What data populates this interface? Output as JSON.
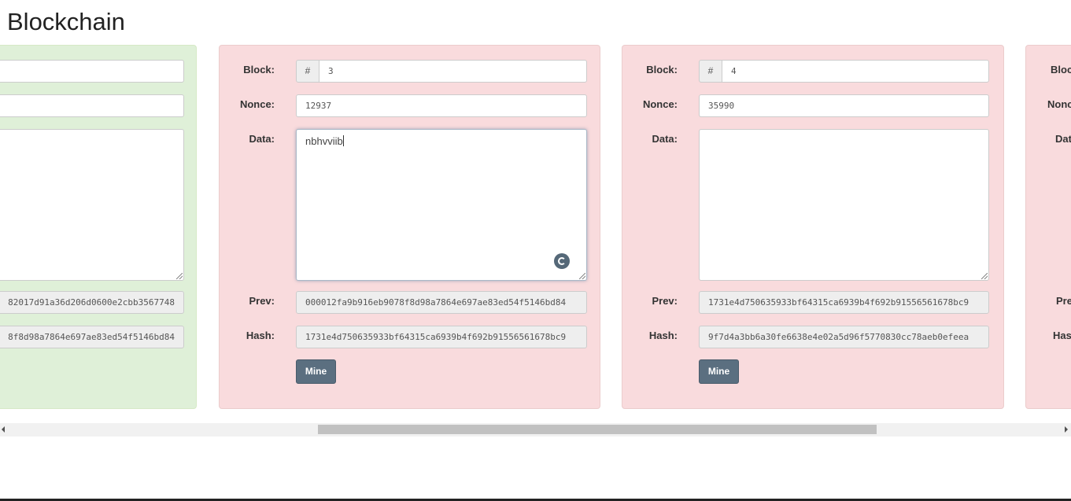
{
  "page": {
    "title": "Blockchain"
  },
  "labels": {
    "block": "Block:",
    "nonce": "Nonce:",
    "data": "Data:",
    "prev": "Prev:",
    "hash": "Hash:",
    "mine": "Mine",
    "hash_prefix": "#"
  },
  "labels_cut": {
    "block": "Block",
    "nonce": "Nonc",
    "data": "Dat",
    "prev": "Pre",
    "hash": "Has"
  },
  "blocks": [
    {
      "status": "valid",
      "block": "",
      "nonce": "",
      "data": "",
      "prev": "82017d91a36d206d0600e2cbb3567748",
      "hash": "8f8d98a7864e697ae83ed54f5146bd84"
    },
    {
      "status": "invalid",
      "block": "3",
      "nonce": "12937",
      "data": "nbhvviib",
      "prev": "000012fa9b916eb9078f8d98a7864e697ae83ed54f5146bd84",
      "hash": "1731e4d750635933bf64315ca6939b4f692b91556561678bc9"
    },
    {
      "status": "invalid",
      "block": "4",
      "nonce": "35990",
      "data": "",
      "prev": "1731e4d750635933bf64315ca6939b4f692b91556561678bc9",
      "hash": "9f7d4a3bb6a30fe6638e4e02a5d96f5770830cc78aeb0efeea"
    }
  ],
  "scrollbar": {
    "position_fraction": 0.52
  },
  "colors": {
    "valid_bg": "#dff0d8",
    "invalid_bg": "#f9dbdd",
    "button": "#5b6f80"
  }
}
